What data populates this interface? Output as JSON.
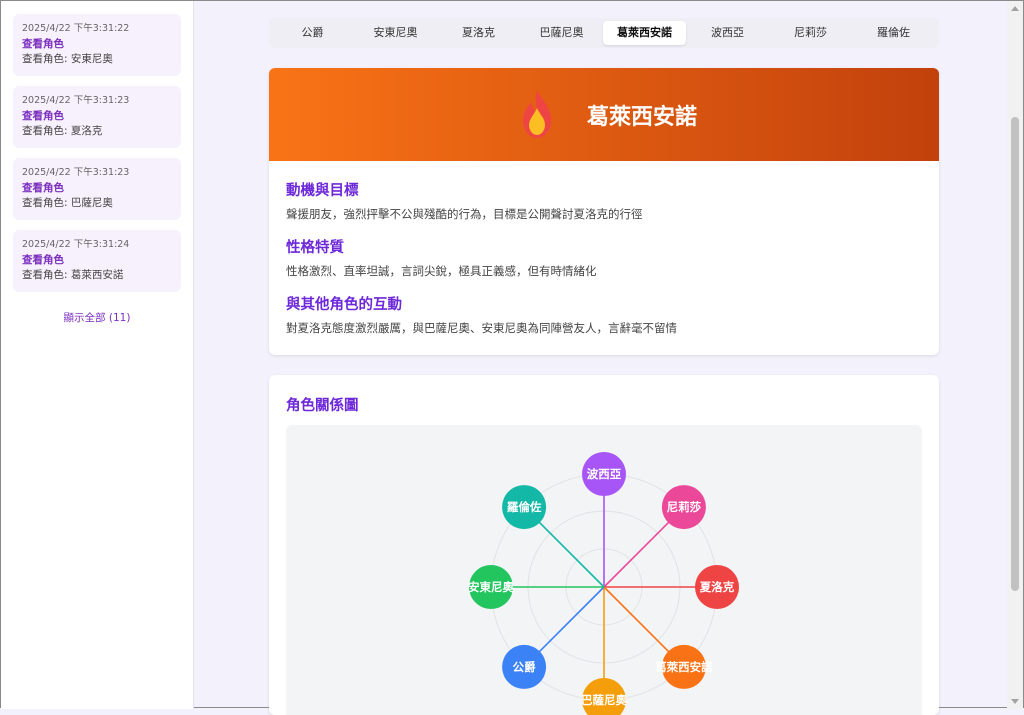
{
  "sidebar": {
    "logs": [
      {
        "time": "2025/4/22 下午3:31:22",
        "action": "查看角色",
        "detail": "查看角色: 安東尼奧"
      },
      {
        "time": "2025/4/22 下午3:31:23",
        "action": "查看角色",
        "detail": "查看角色: 夏洛克"
      },
      {
        "time": "2025/4/22 下午3:31:23",
        "action": "查看角色",
        "detail": "查看角色: 巴薩尼奧"
      },
      {
        "time": "2025/4/22 下午3:31:24",
        "action": "查看角色",
        "detail": "查看角色: 葛萊西安諾"
      }
    ],
    "show_all": "顯示全部 (11)"
  },
  "tabs": [
    "公爵",
    "安東尼奧",
    "夏洛克",
    "巴薩尼奧",
    "葛萊西安諾",
    "波西亞",
    "尼莉莎",
    "羅倫佐"
  ],
  "active_tab": "葛萊西安諾",
  "profile": {
    "name": "葛萊西安諾",
    "icon": "flame-icon",
    "sections": [
      {
        "title": "動機與目標",
        "text": "聲援朋友，強烈抨擊不公與殘酷的行為，目標是公開聲討夏洛克的行徑"
      },
      {
        "title": "性格特質",
        "text": "性格激烈、直率坦誠，言詞尖銳，極具正義感，但有時情緒化"
      },
      {
        "title": "與其他角色的互動",
        "text": "對夏洛克態度激烈嚴厲，與巴薩尼奧、安東尼奧為同陣營友人，言辭毫不留情"
      }
    ]
  },
  "relations": {
    "title": "角色關係圖",
    "nodes": [
      {
        "name": "波西亞",
        "color": "#a855f7",
        "angle": -90
      },
      {
        "name": "尼莉莎",
        "color": "#ec4899",
        "angle": -45
      },
      {
        "name": "夏洛克",
        "color": "#ef4444",
        "angle": 0
      },
      {
        "name": "葛萊西安諾",
        "color": "#f97316",
        "angle": 45
      },
      {
        "name": "巴薩尼奧",
        "color": "#f59e0b",
        "angle": 90
      },
      {
        "name": "公爵",
        "color": "#3b82f6",
        "angle": 135
      },
      {
        "name": "安東尼奧",
        "color": "#22c55e",
        "angle": 180
      },
      {
        "name": "羅倫佐",
        "color": "#14b8a6",
        "angle": 225
      }
    ]
  },
  "colors": {
    "accent": "#7b2fbf",
    "header_start": "#f97316",
    "header_end": "#c2410c"
  }
}
